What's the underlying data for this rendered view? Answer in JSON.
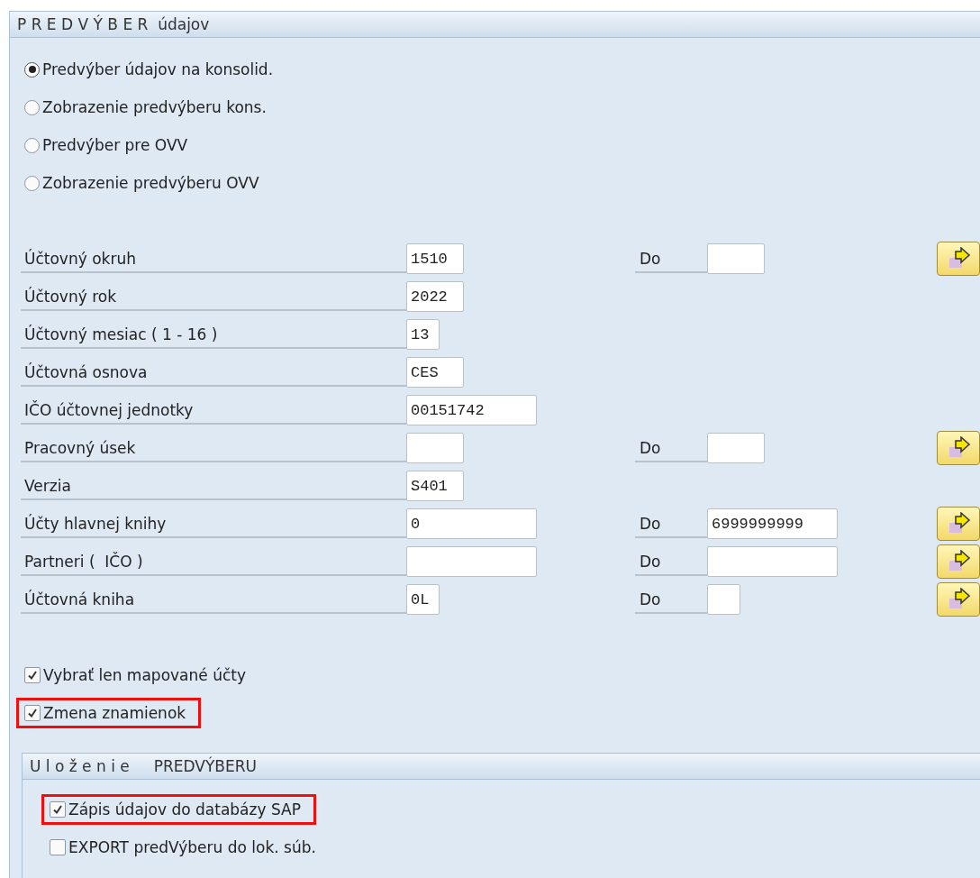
{
  "panel": {
    "title": "P R E D V Ý B E R  údajov"
  },
  "radios": [
    {
      "label": "Predvýber údajov na konsolid.",
      "selected": true
    },
    {
      "label": "Zobrazenie predvýberu kons.",
      "selected": false
    },
    {
      "label": "Predvýber pre OVV",
      "selected": false
    },
    {
      "label": "Zobrazenie predvýberu OVV",
      "selected": false
    }
  ],
  "fields": [
    {
      "label": "Účtovný okruh",
      "from": {
        "value": "1510"
      },
      "to": {
        "label": "Do"
      },
      "multiple_selection": true
    },
    {
      "label": "Účtovný rok",
      "from": {
        "value": "2022"
      },
      "multiple_selection": false
    },
    {
      "label": "Účtovný mesiac ( 1 - 16 )",
      "from": {
        "value": "13"
      },
      "multiple_selection": false
    },
    {
      "label": "Účtovná osnova",
      "from": {
        "value": "CES"
      },
      "multiple_selection": false
    },
    {
      "label": "IČO účtovnej jednotky",
      "from": {
        "value": "00151742"
      },
      "multiple_selection": false
    },
    {
      "label": "Pracovný úsek",
      "to": {
        "label": "Do"
      },
      "multiple_selection": true
    },
    {
      "label": "Verzia",
      "from": {
        "value": "S401"
      },
      "multiple_selection": false
    },
    {
      "label": "Účty hlavnej knihy",
      "from": {
        "value": "0"
      },
      "to": {
        "label": "Do",
        "value": "6999999999"
      },
      "multiple_selection": true
    },
    {
      "label": "Partneri (  IČO )",
      "to": {
        "label": "Do"
      },
      "multiple_selection": true
    },
    {
      "label": "Účtovná kniha",
      "from": {
        "value": "0L"
      },
      "to": {
        "label": "Do"
      },
      "multiple_selection": true
    }
  ],
  "options": [
    {
      "label": "Vybrať len mapované účty",
      "checked": true,
      "highlighted": false
    },
    {
      "label": "Zmena znamienok",
      "checked": true,
      "highlighted": true
    }
  ],
  "save_panel": {
    "title": "U l o ž e n i e     PREDVÝBERU",
    "options": [
      {
        "label": "Zápis údajov do databázy SAP",
        "checked": true,
        "highlighted": true
      },
      {
        "label": "EXPORT predVýberu do lok. súb.",
        "checked": false,
        "highlighted": false
      }
    ]
  }
}
